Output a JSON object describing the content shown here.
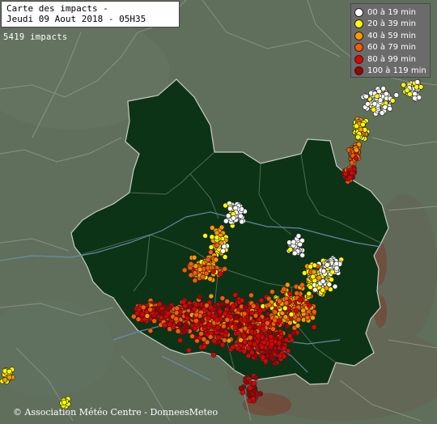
{
  "header": {
    "title": "Carte des impacts -",
    "date_line": "Jeudi 09 Aout 2018 - 05H35"
  },
  "impacts_count": "5419 impacts",
  "legend": [
    {
      "label": "00 à 19 min",
      "color": "#ffffff"
    },
    {
      "label": "20 à 39 min",
      "color": "#ffff00"
    },
    {
      "label": "40 à 59 min",
      "color": "#ff9900"
    },
    {
      "label": "60 à 79 min",
      "color": "#ff5a00"
    },
    {
      "label": "80 à 99 min",
      "color": "#e00000"
    },
    {
      "label": "100 à 119 min",
      "color": "#a00000"
    }
  ],
  "copyright": "© Association Météo Centre - DonneesMeteo",
  "colors": {
    "region_fill": "#0d3316",
    "background": "#5f6f5c",
    "borders": "#8a8f86",
    "rivers": "#6d8fb0",
    "relief": "#7a3b2a"
  }
}
